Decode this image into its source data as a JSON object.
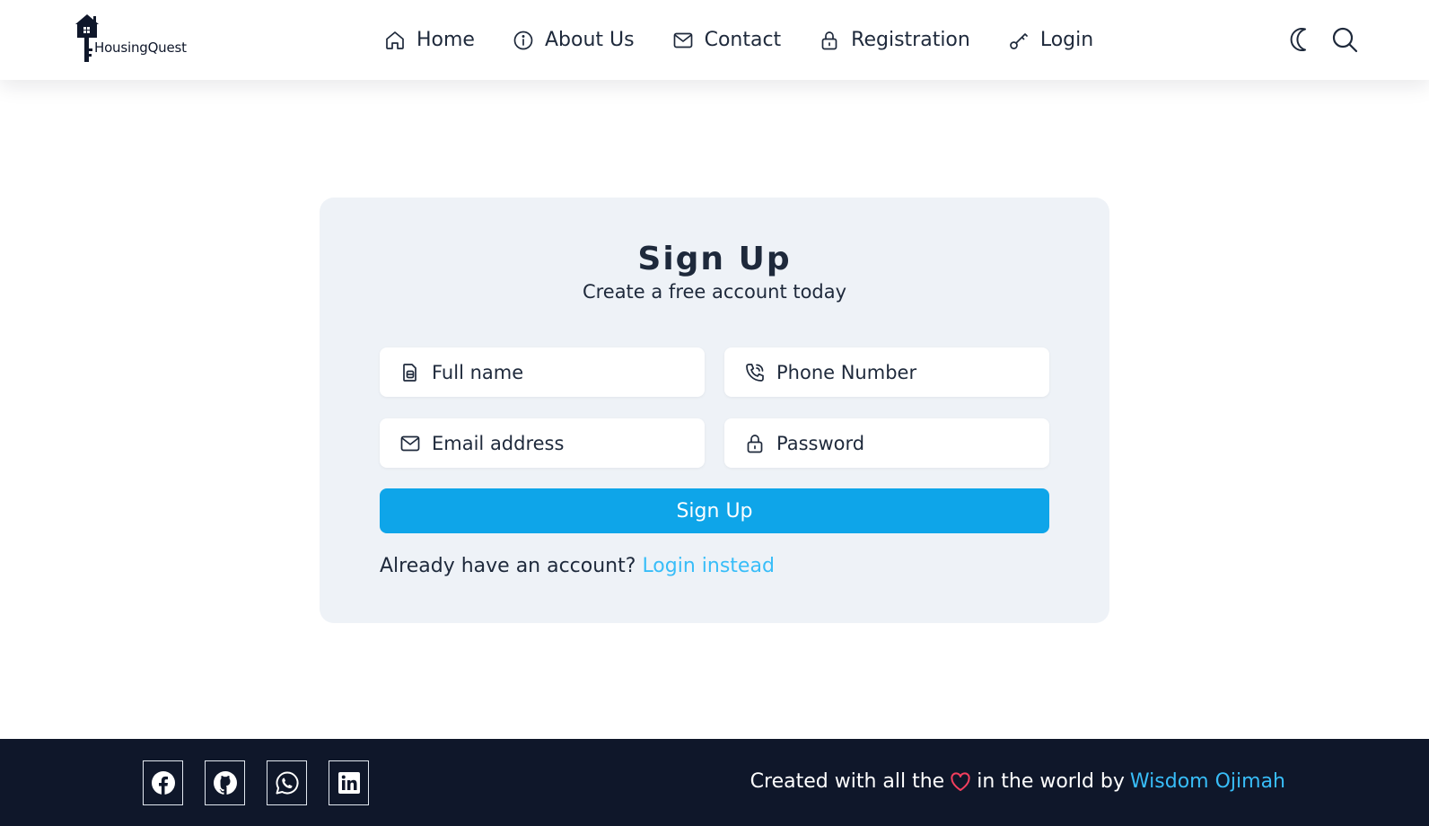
{
  "brand": {
    "name": "HousingQuest"
  },
  "nav": {
    "items": [
      {
        "label": "Home",
        "icon": "home-icon"
      },
      {
        "label": "About Us",
        "icon": "info-icon"
      },
      {
        "label": "Contact",
        "icon": "mail-icon"
      },
      {
        "label": "Registration",
        "icon": "lock-icon"
      },
      {
        "label": "Login",
        "icon": "key-icon"
      }
    ],
    "actions": [
      {
        "icon": "moon-icon"
      },
      {
        "icon": "search-icon"
      }
    ]
  },
  "signup": {
    "title": "Sign Up",
    "subtitle": "Create a free account today",
    "fields": {
      "full_name": {
        "placeholder": "Full name",
        "value": "",
        "icon": "document-icon"
      },
      "phone": {
        "placeholder": "Phone Number",
        "value": "",
        "icon": "phone-icon"
      },
      "email": {
        "placeholder": "Email address",
        "value": "",
        "icon": "mail-icon"
      },
      "password": {
        "placeholder": "Password",
        "value": "",
        "icon": "lock-icon"
      }
    },
    "submit_label": "Sign Up",
    "switch_prompt": "Already have an account?",
    "switch_link": "Login instead"
  },
  "footer": {
    "socials": [
      {
        "icon": "facebook-icon"
      },
      {
        "icon": "github-icon"
      },
      {
        "icon": "whatsapp-icon"
      },
      {
        "icon": "linkedin-icon"
      }
    ],
    "credit_prefix": "Created with all the",
    "credit_middle": "in the world by",
    "author": "Wisdom Ojimah"
  },
  "colors": {
    "accent": "#0ea5e9",
    "link": "#38bdf8",
    "footer_bg": "#0f172a",
    "card_bg": "#eef2f7",
    "heart": "#f43f5e"
  }
}
